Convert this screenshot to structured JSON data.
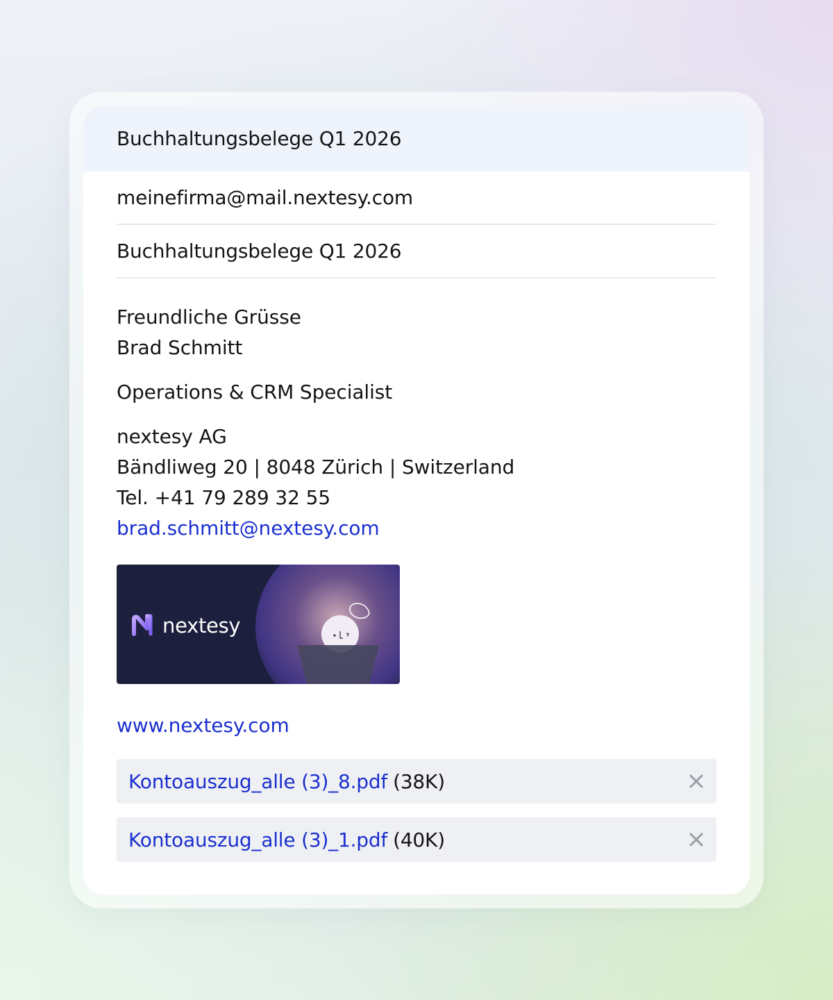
{
  "header": {
    "title": "Buchhaltungsbelege Q1 2026"
  },
  "fields": {
    "to": "meinefirma@mail.nextesy.com",
    "subject": "Buchhaltungsbelege Q1 2026"
  },
  "signature": {
    "greeting": "Freundliche Grüsse",
    "name": "Brad Schmitt",
    "role": "Operations & CRM Specialist",
    "company": "nextesy AG",
    "address": "Bändliweg 20 | 8048 Zürich | Switzerland",
    "phone": "Tel. +41 79 289 32 55",
    "email": "brad.schmitt@nextesy.com",
    "banner_wordmark": "nextesy",
    "website": "www.nextesy.com"
  },
  "attachments": [
    {
      "name": "Kontoauszug_alle (3)_8.pdf",
      "size": "(38K)"
    },
    {
      "name": "Kontoauszug_alle (3)_1.pdf",
      "size": "(40K)"
    }
  ],
  "icons": {
    "remove": "close-icon",
    "logo": "nextesy-logo-icon"
  },
  "colors": {
    "link": "#1a2fd0",
    "header_bg": "#eff3fc",
    "attachment_bg": "#eff0f4",
    "banner_bg": "#1c1f3d"
  }
}
